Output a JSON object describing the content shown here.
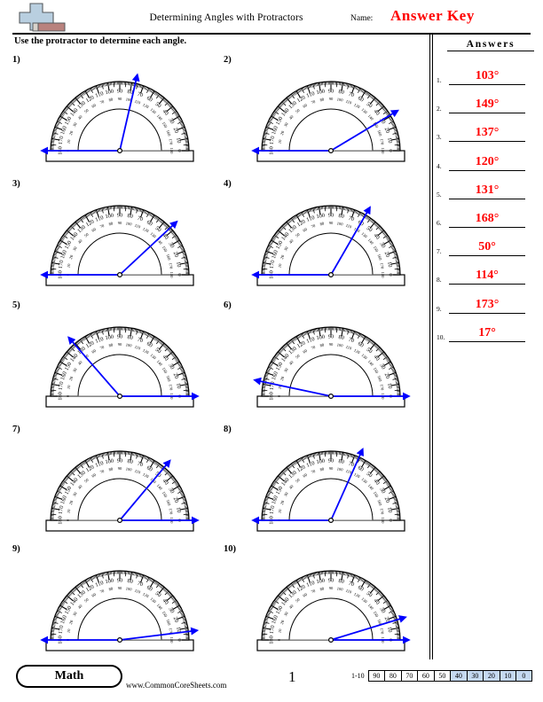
{
  "header": {
    "title": "Determining Angles with Protractors",
    "name_label": "Name:",
    "answer_key": "Answer Key",
    "instruction": "Use the protractor to determine each angle.",
    "logo_icon": "plus-block-logo"
  },
  "answers": {
    "title": "Answers",
    "items": [
      {
        "num": "1.",
        "value": "103°"
      },
      {
        "num": "2.",
        "value": "149°"
      },
      {
        "num": "3.",
        "value": "137°"
      },
      {
        "num": "4.",
        "value": "120°"
      },
      {
        "num": "5.",
        "value": "131°"
      },
      {
        "num": "6.",
        "value": "168°"
      },
      {
        "num": "7.",
        "value": "50°"
      },
      {
        "num": "8.",
        "value": "114°"
      },
      {
        "num": "9.",
        "value": "173°"
      },
      {
        "num": "10.",
        "value": "17°"
      }
    ]
  },
  "problems": [
    {
      "num": "1)",
      "angle": 103,
      "base_ray": "left",
      "col": 0,
      "row": 0
    },
    {
      "num": "2)",
      "angle": 149,
      "base_ray": "left",
      "col": 1,
      "row": 0
    },
    {
      "num": "3)",
      "angle": 137,
      "base_ray": "left",
      "col": 0,
      "row": 1
    },
    {
      "num": "4)",
      "angle": 120,
      "base_ray": "left",
      "col": 1,
      "row": 1
    },
    {
      "num": "5)",
      "angle": 131,
      "base_ray": "right",
      "col": 0,
      "row": 2
    },
    {
      "num": "6)",
      "angle": 168,
      "base_ray": "right",
      "col": 1,
      "row": 2
    },
    {
      "num": "7)",
      "angle": 50,
      "base_ray": "right",
      "col": 0,
      "row": 3
    },
    {
      "num": "8)",
      "angle": 114,
      "base_ray": "left",
      "col": 1,
      "row": 3
    },
    {
      "num": "9)",
      "angle": 173,
      "base_ray": "left",
      "col": 0,
      "row": 4
    },
    {
      "num": "10)",
      "angle": 17,
      "base_ray": "right",
      "col": 1,
      "row": 4
    }
  ],
  "protractor": {
    "outer_labels": [
      0,
      10,
      20,
      30,
      40,
      50,
      60,
      70,
      80,
      90,
      100,
      110,
      120,
      130,
      140,
      150,
      160,
      170,
      180
    ],
    "ray_color": "#0000ff",
    "body_color": "#000000"
  },
  "footer": {
    "badge": "Math",
    "url": "www.CommonCoreSheets.com",
    "page_number": "1",
    "scale_label": "1-10",
    "scale_cells": [
      {
        "label": "90",
        "highlight": false
      },
      {
        "label": "80",
        "highlight": false
      },
      {
        "label": "70",
        "highlight": false
      },
      {
        "label": "60",
        "highlight": false
      },
      {
        "label": "50",
        "highlight": false
      },
      {
        "label": "40",
        "highlight": true
      },
      {
        "label": "30",
        "highlight": true
      },
      {
        "label": "20",
        "highlight": true
      },
      {
        "label": "10",
        "highlight": true
      },
      {
        "label": "0",
        "highlight": true
      }
    ],
    "highlight_color": "#c5d9f1"
  }
}
